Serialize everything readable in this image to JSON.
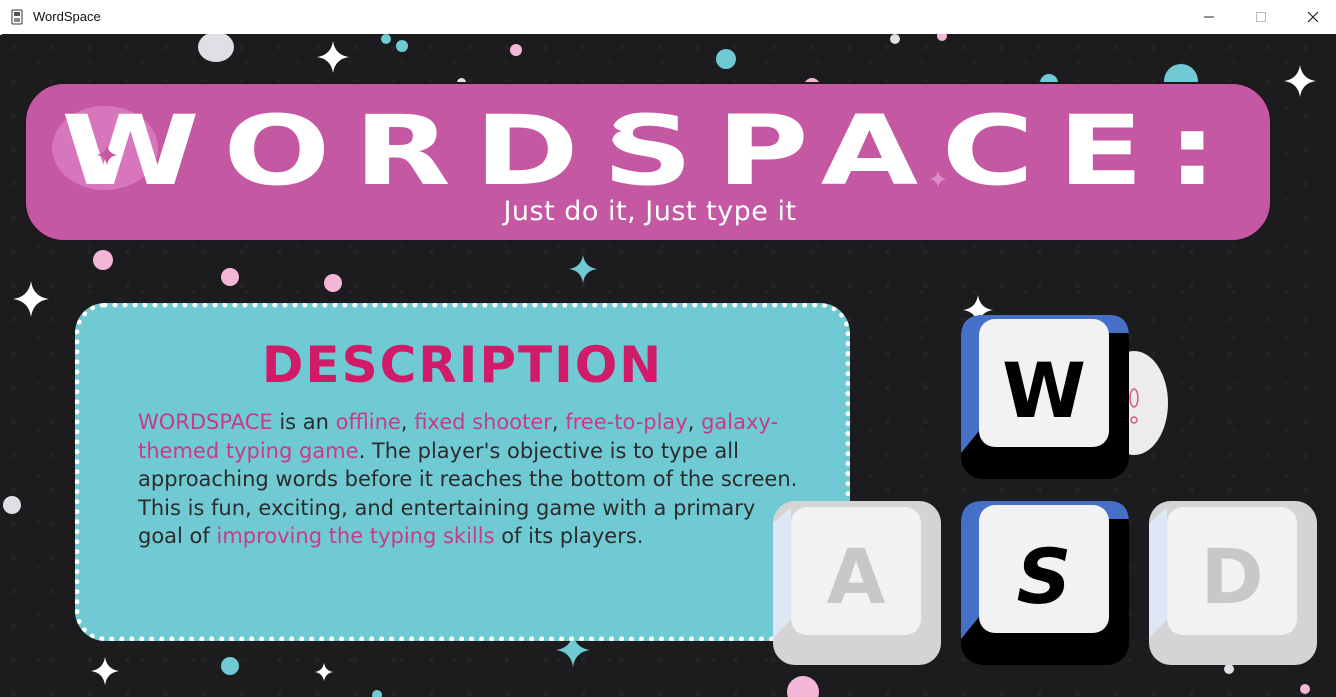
{
  "window": {
    "title": "WordSpace",
    "controls": [
      "minimize",
      "maximize",
      "close"
    ]
  },
  "banner": {
    "logo_text": "WORDSPACE:",
    "tagline": "Just do it, Just type it"
  },
  "description": {
    "heading": "DESCRIPTION",
    "segments": [
      {
        "text": "WORDSPACE",
        "highlight": true
      },
      {
        "text": " is an ",
        "highlight": false
      },
      {
        "text": "offline",
        "highlight": true
      },
      {
        "text": ", ",
        "highlight": false
      },
      {
        "text": "fixed shooter",
        "highlight": true
      },
      {
        "text": ", ",
        "highlight": false
      },
      {
        "text": "free-to-play",
        "highlight": true
      },
      {
        "text": ", ",
        "highlight": false
      },
      {
        "text": "galaxy-themed typing game",
        "highlight": true
      },
      {
        "text": ". The player's objective is to type all approaching words before it reaches the bottom of the screen. This is fun, exciting, and entertaining game with a primary goal of ",
        "highlight": false
      },
      {
        "text": "improving the typing skills",
        "highlight": true
      },
      {
        "text": " of its players.",
        "highlight": false
      }
    ]
  },
  "keys": [
    {
      "label": "W",
      "state": "pressed"
    },
    {
      "label": "A",
      "state": "idle"
    },
    {
      "label": "S",
      "state": "pressed"
    },
    {
      "label": "D",
      "state": "idle"
    }
  ],
  "colors": {
    "background": "#1c1c1e",
    "banner": "#c558a2",
    "card": "#6fcad3",
    "heading": "#d11a68",
    "highlight": "#c93a86",
    "key_pressed_side": "#4670c8",
    "key_idle_side": "#d4d4d4"
  },
  "icons": [
    "app-icon",
    "minimize-icon",
    "maximize-icon",
    "close-icon",
    "star-icon",
    "planet-icon"
  ]
}
